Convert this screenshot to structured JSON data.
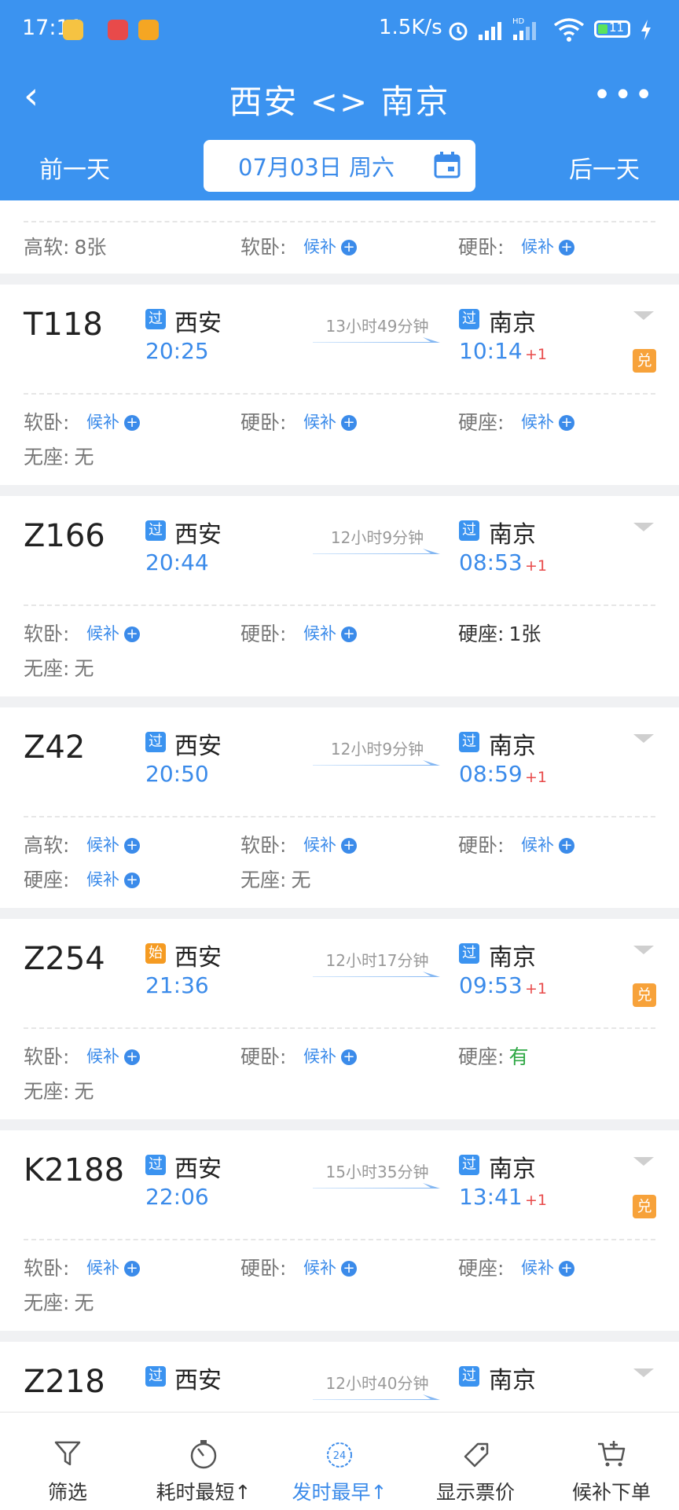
{
  "status_bar": {
    "time": "17:11",
    "net_speed": "1.5K/s",
    "battery": "11",
    "hd_label": "HD"
  },
  "header": {
    "title": "西安 <> 南京",
    "more": "•••",
    "back": "‹"
  },
  "date_bar": {
    "prev": "前一天",
    "date": "07月03日 周六",
    "next": "后一天"
  },
  "partial_card": {
    "seats": [
      {
        "label": "高软:",
        "value": "8张",
        "houbu": false
      },
      {
        "label": "软卧:",
        "value": "候补",
        "houbu": true
      },
      {
        "label": "硬卧:",
        "value": "候补",
        "houbu": true
      }
    ]
  },
  "trains": [
    {
      "no": "T118",
      "from_tag": "过",
      "from": "西安",
      "depart": "20:25",
      "duration": "13小时49分钟",
      "to_tag": "过",
      "to": "南京",
      "arrive": "10:14",
      "day_offset": "+1",
      "dui": true,
      "seats": [
        {
          "label": "软卧:",
          "value": "候补",
          "houbu": true
        },
        {
          "label": "硬卧:",
          "value": "候补",
          "houbu": true
        },
        {
          "label": "硬座:",
          "value": "候补",
          "houbu": true
        },
        {
          "label": "无座:",
          "value": "无",
          "houbu": false
        }
      ]
    },
    {
      "no": "Z166",
      "from_tag": "过",
      "from": "西安",
      "depart": "20:44",
      "duration": "12小时9分钟",
      "to_tag": "过",
      "to": "南京",
      "arrive": "08:53",
      "day_offset": "+1",
      "dui": false,
      "seats": [
        {
          "label": "软卧:",
          "value": "候补",
          "houbu": true
        },
        {
          "label": "硬卧:",
          "value": "候补",
          "houbu": true
        },
        {
          "label": "硬座:",
          "value": "1张",
          "houbu": false,
          "black": true
        },
        {
          "label": "无座:",
          "value": "无",
          "houbu": false
        }
      ]
    },
    {
      "no": "Z42",
      "from_tag": "过",
      "from": "西安",
      "depart": "20:50",
      "duration": "12小时9分钟",
      "to_tag": "过",
      "to": "南京",
      "arrive": "08:59",
      "day_offset": "+1",
      "dui": false,
      "seats": [
        {
          "label": "高软:",
          "value": "候补",
          "houbu": true
        },
        {
          "label": "软卧:",
          "value": "候补",
          "houbu": true
        },
        {
          "label": "硬卧:",
          "value": "候补",
          "houbu": true
        },
        {
          "label": "硬座:",
          "value": "候补",
          "houbu": true
        },
        {
          "label": "无座:",
          "value": "无",
          "houbu": false
        }
      ]
    },
    {
      "no": "Z254",
      "from_tag": "始",
      "from": "西安",
      "depart": "21:36",
      "duration": "12小时17分钟",
      "to_tag": "过",
      "to": "南京",
      "arrive": "09:53",
      "day_offset": "+1",
      "dui": true,
      "seats": [
        {
          "label": "软卧:",
          "value": "候补",
          "houbu": true
        },
        {
          "label": "硬卧:",
          "value": "候补",
          "houbu": true
        },
        {
          "label": "硬座:",
          "value": "有",
          "houbu": false,
          "green": true
        },
        {
          "label": "无座:",
          "value": "无",
          "houbu": false
        }
      ]
    },
    {
      "no": "K2188",
      "from_tag": "过",
      "from": "西安",
      "depart": "22:06",
      "duration": "15小时35分钟",
      "to_tag": "过",
      "to": "南京",
      "arrive": "13:41",
      "day_offset": "+1",
      "dui": true,
      "seats": [
        {
          "label": "软卧:",
          "value": "候补",
          "houbu": true
        },
        {
          "label": "硬卧:",
          "value": "候补",
          "houbu": true
        },
        {
          "label": "硬座:",
          "value": "候补",
          "houbu": true
        },
        {
          "label": "无座:",
          "value": "无",
          "houbu": false
        }
      ]
    },
    {
      "no": "Z218",
      "from_tag": "过",
      "from": "西安",
      "depart": "",
      "duration": "12小时40分钟",
      "to_tag": "过",
      "to": "南京",
      "arrive": "",
      "day_offset": "",
      "dui": false,
      "seats": []
    }
  ],
  "dui_label": "兑",
  "bottom_tabs": [
    {
      "label": "筛选",
      "icon": "filter-icon",
      "active": false
    },
    {
      "label": "耗时最短↑",
      "icon": "stopwatch-icon",
      "active": false
    },
    {
      "label": "发时最早↑",
      "icon": "clock-24-icon",
      "active": true
    },
    {
      "label": "显示票价",
      "icon": "price-tag-icon",
      "active": false
    },
    {
      "label": "候补下单",
      "icon": "cart-icon",
      "active": false
    }
  ],
  "clock_icon_text": "24",
  "colors": {
    "primary": "#3b93f0",
    "link": "#3b8bea",
    "start_tag": "#f59b22",
    "dui": "#f7a23a",
    "plus": "#e84a4a",
    "available": "#2fa845"
  }
}
